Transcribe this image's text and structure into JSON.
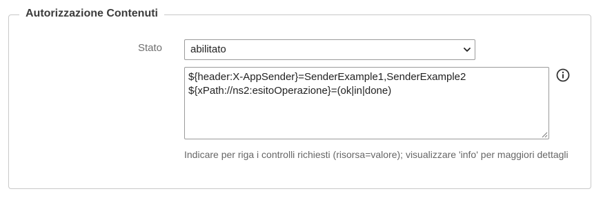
{
  "section": {
    "title": "Autorizzazione Contenuti"
  },
  "stato": {
    "label": "Stato",
    "selected": "abilitato"
  },
  "rules": {
    "lines": [
      "${header:X-AppSender}=SenderExample1,SenderExample2",
      "${xPath://ns2:esitoOperazione}=(ok|in|done)"
    ],
    "help_text": "Indicare per riga i controlli richiesti (risorsa=valore); visualizzare 'info' per maggiori dettagli"
  },
  "icons": {
    "info": "info-circle-icon",
    "dropdown": "chevron-down-icon",
    "resize": "resize-handle-icon"
  }
}
